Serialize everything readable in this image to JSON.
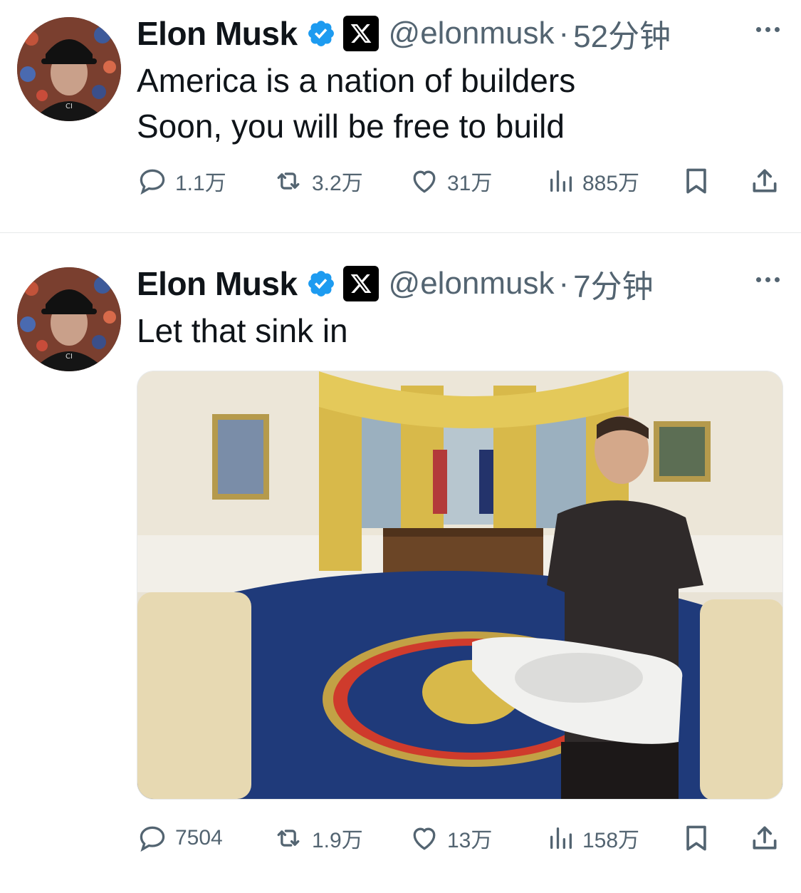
{
  "tweets": [
    {
      "author": "Elon Musk",
      "handle": "@elonmusk",
      "separator": "·",
      "time": "52分钟",
      "lines": [
        "America is a nation of builders",
        "Soon, you will be free to build"
      ],
      "stats": {
        "replies": "1.1万",
        "retweets": "3.2万",
        "likes": "31万",
        "views": "885万"
      }
    },
    {
      "author": "Elon Musk",
      "handle": "@elonmusk",
      "separator": "·",
      "time": "7分钟",
      "lines": [
        "Let that sink in"
      ],
      "stats": {
        "replies": "7504",
        "retweets": "1.9万",
        "likes": "13万",
        "views": "158万"
      }
    }
  ],
  "icons": {
    "verified": "verified-badge-icon",
    "affiliation": "x-logo-icon",
    "more": "more-icon",
    "reply": "reply-icon",
    "retweet": "retweet-icon",
    "like": "heart-icon",
    "views": "views-icon",
    "bookmark": "bookmark-icon",
    "share": "share-icon"
  },
  "colors": {
    "verified": "#1d9bf0",
    "secondary_text": "#536471",
    "primary_text": "#0f1419"
  }
}
